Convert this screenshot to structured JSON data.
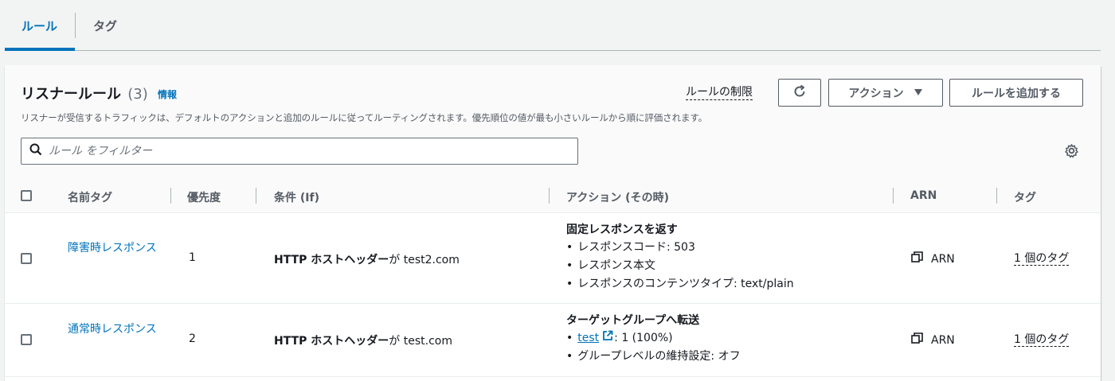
{
  "tabs": [
    {
      "label": "ルール",
      "active": true
    },
    {
      "label": "タグ",
      "active": false
    }
  ],
  "panel": {
    "title": "リスナールール",
    "count": "(3)",
    "info": "情報",
    "description": "リスナーが受信するトラフィックは、デフォルトのアクションと追加のルールに従ってルーティングされます。優先順位の値が最も小さいルールから順に評価されます。",
    "rule_limits": "ルールの制限",
    "actions_label": "アクション",
    "add_rule_label": "ルールを追加する",
    "search_placeholder": "ルール をフィルター"
  },
  "columns": {
    "name": "名前タグ",
    "priority": "優先度",
    "condition": "条件 (If)",
    "action": "アクション (その時)",
    "arn": "ARN",
    "tags": "タグ"
  },
  "rows": [
    {
      "name": "障害時レスポンス",
      "priority": "1",
      "condition_bold": "HTTP ホストヘッダー",
      "condition_rest": "が test2.com",
      "action_title": "固定レスポンスを返す",
      "action_items": [
        "レスポンスコード: 503",
        "レスポンス本文",
        "レスポンスのコンテンツタイプ: text/plain"
      ],
      "arn": "ARN",
      "tags": "1 個のタグ"
    },
    {
      "name": "通常時レスポンス",
      "priority": "2",
      "condition_bold": "HTTP ホストヘッダー",
      "condition_rest": "が test.com",
      "action_title": "ターゲットグループへ転送",
      "target_group": "test",
      "target_weight": ": 1 (100%)",
      "action_items": [
        "グループレベルの維持設定: オフ"
      ],
      "arn": "ARN",
      "tags": "1 個のタグ"
    }
  ],
  "colors": {
    "link": "#0073bb",
    "text": "#16191f",
    "muted": "#545b64"
  }
}
